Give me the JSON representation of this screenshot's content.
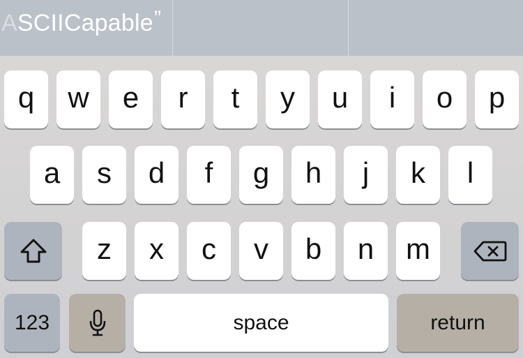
{
  "predictive_bar": {
    "suggestion_faded_prefix": "A",
    "suggestion_text": "SCIICapable",
    "close_quote": "”"
  },
  "keyboard": {
    "row1": [
      "q",
      "w",
      "e",
      "r",
      "t",
      "y",
      "u",
      "i",
      "o",
      "p"
    ],
    "row2": [
      "a",
      "s",
      "d",
      "f",
      "g",
      "h",
      "j",
      "k",
      "l"
    ],
    "row3": [
      "z",
      "x",
      "c",
      "v",
      "b",
      "n",
      "m"
    ],
    "numbers_label": "123",
    "space_label": "space",
    "return_label": "return",
    "shift_icon": "shift-arrow-icon",
    "delete_icon": "backspace-icon",
    "mic_icon": "microphone-icon"
  }
}
